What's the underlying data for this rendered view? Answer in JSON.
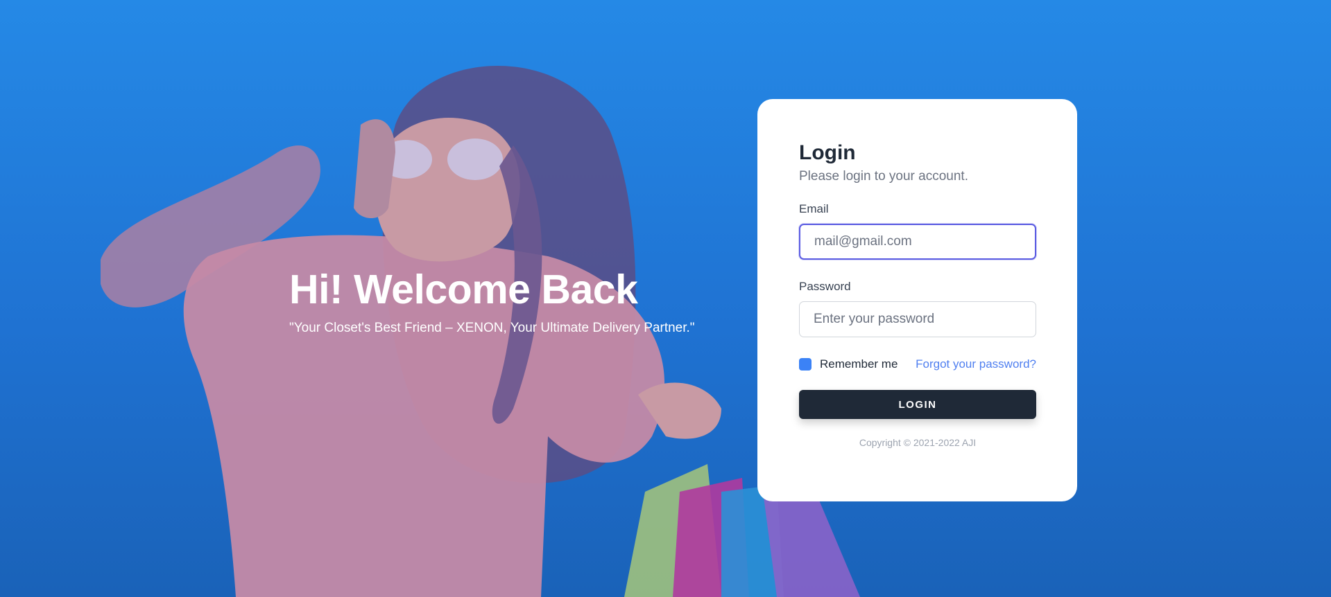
{
  "hero": {
    "title": "Hi! Welcome Back",
    "tagline": "\"Your Closet's Best Friend – XENON, Your Ultimate Delivery Partner.\""
  },
  "login": {
    "heading": "Login",
    "subtitle": "Please login to your account.",
    "email_label": "Email",
    "email_placeholder": "mail@gmail.com",
    "email_value": "",
    "password_label": "Password",
    "password_placeholder": "Enter your password",
    "password_value": "",
    "remember_label": "Remember me",
    "remember_checked": true,
    "forgot_link": "Forgot your password?",
    "button_label": "LOGIN",
    "copyright": "Copyright © 2021-2022 AJI"
  },
  "colors": {
    "background": "#2589e6",
    "button": "#1f2937",
    "link": "#4f7ff0",
    "checkbox": "#3b82f6",
    "focus_border": "#5b5ce2"
  }
}
